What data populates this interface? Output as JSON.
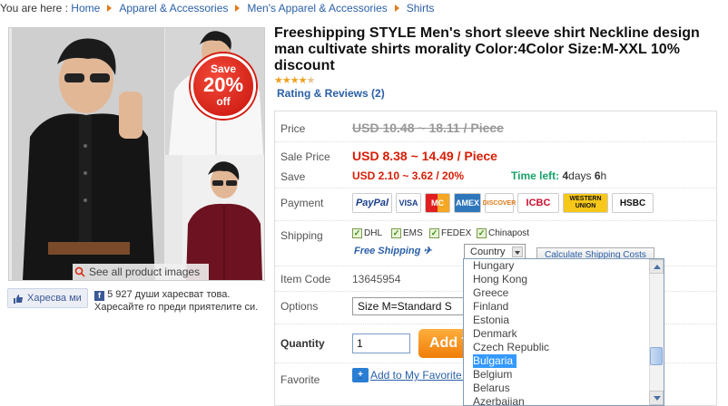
{
  "breadcrumb": {
    "prefix": "You are here :",
    "items": [
      "Home",
      "Apparel & Accessories",
      "Men's Apparel & Accessories",
      "Shirts"
    ]
  },
  "gallery": {
    "badge": {
      "line1": "Save",
      "line2": "20%",
      "line3": "off"
    },
    "see_all": "See all product images"
  },
  "social": {
    "like_label": "Харесва ми",
    "like_text": "5 927 души харесват това. Харесайте го преди приятелите си."
  },
  "product": {
    "title": "Freeshipping STYLE Men's short sleeve shirt Neckline design man cultivate shirts morality Color:4Color Size:M-XXL 10% discount",
    "rating": 4.5,
    "reviews": "Rating & Reviews (2)"
  },
  "details": {
    "price_label": "Price",
    "price_old": "USD 10.48 ~ 18.11 / Piece",
    "sale_label": "Sale Price",
    "sale_price": "USD 8.38 ~ 14.49 / Piece",
    "save_label": "Save",
    "save_value": "USD 2.10 ~ 3.62 / 20%",
    "time_left_label": "Time left:",
    "time_left_days": "4",
    "time_left_days_unit": "days",
    "time_left_hours": "6",
    "time_left_hours_unit": "h",
    "payment_label": "Payment",
    "payment_methods": [
      "PayPal",
      "VISA",
      "MC",
      "AMEX",
      "DISCOVER",
      "ICBC",
      "WESTERN UNION",
      "HSBC"
    ],
    "shipping_label": "Shipping",
    "shipping_options": [
      "DHL",
      "EMS",
      "FEDEX",
      "Chinapost"
    ],
    "free_shipping": "Free Shipping",
    "country_select": "Country",
    "calc_button": "Calculate Shipping Costs",
    "item_code_label": "Item Code",
    "item_code": "13645954",
    "options_label": "Options",
    "size_select": "Size M=Standard S",
    "quantity_label": "Quantity",
    "quantity_value": "1",
    "add_button": "Add T",
    "favorite_label": "Favorite",
    "favorite_link": "Add to My Favorite F"
  },
  "country_dropdown": {
    "items": [
      "Hungary",
      "Hong Kong",
      "Greece",
      "Finland",
      "Estonia",
      "Denmark",
      "Czech Republic",
      "Bulgaria",
      "Belgium",
      "Belarus",
      "Azerbaijan"
    ],
    "selected": "Bulgaria"
  },
  "colors": {
    "link": "#2a5fa8",
    "sale_red": "#d81e06",
    "time_green": "#18a26a",
    "accent_orange": "#f07d0a"
  }
}
